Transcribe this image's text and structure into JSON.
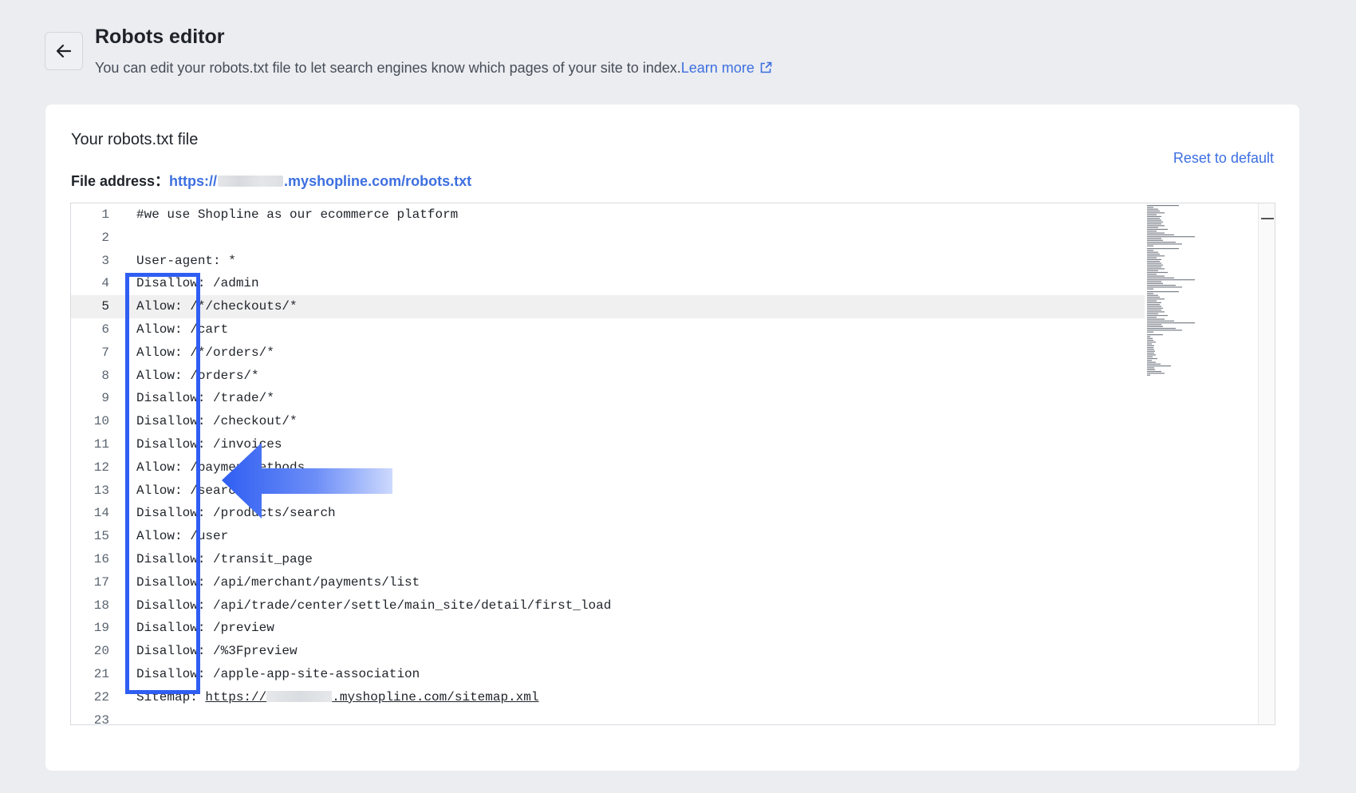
{
  "header": {
    "title": "Robots editor",
    "subtitle": "You can edit your robots.txt file to let search engines know which pages of your site to index.",
    "learn_more": "Learn more"
  },
  "card": {
    "title": "Your robots.txt file",
    "reset_label": "Reset to default",
    "file_address_label": "File address：",
    "file_address_prefix": "https://",
    "file_address_suffix": ".myshopline.com/robots.txt"
  },
  "editor": {
    "active_line": 5,
    "lines": [
      {
        "num": "1",
        "text": "#we use Shopline as our ecommerce platform"
      },
      {
        "num": "2",
        "text": ""
      },
      {
        "num": "3",
        "text": "User-agent: *"
      },
      {
        "num": "4",
        "text": "Disallow: /admin"
      },
      {
        "num": "5",
        "text": "Allow: /*/checkouts/*"
      },
      {
        "num": "6",
        "text": "Allow: /cart"
      },
      {
        "num": "7",
        "text": "Allow: /*/orders/*"
      },
      {
        "num": "8",
        "text": "Allow: /orders/*"
      },
      {
        "num": "9",
        "text": "Disallow: /trade/*"
      },
      {
        "num": "10",
        "text": "Disallow: /checkout/*"
      },
      {
        "num": "11",
        "text": "Disallow: /invoices"
      },
      {
        "num": "12",
        "text": "Allow: /paymentMethods"
      },
      {
        "num": "13",
        "text": "Allow: /search"
      },
      {
        "num": "14",
        "text": "Disallow: /products/search"
      },
      {
        "num": "15",
        "text": "Allow: /user"
      },
      {
        "num": "16",
        "text": "Disallow: /transit_page"
      },
      {
        "num": "17",
        "text": "Disallow: /api/merchant/payments/list"
      },
      {
        "num": "18",
        "text": "Disallow: /api/trade/center/settle/main_site/detail/first_load"
      },
      {
        "num": "19",
        "text": "Disallow: /preview"
      },
      {
        "num": "20",
        "text": "Disallow: /%3Fpreview"
      },
      {
        "num": "21",
        "text": "Disallow: /apple-app-site-association"
      },
      {
        "num": "22",
        "text": "Sitemap: "
      },
      {
        "num": "23",
        "text": ""
      }
    ],
    "sitemap_prefix": "https://",
    "sitemap_suffix": ".myshopline.com/sitemap.xml"
  },
  "annotation": {
    "box_color": "#2f5ef2",
    "arrow_color": "#3d6ff7"
  },
  "colors": {
    "link": "#3d6fe0",
    "background": "#ebedf1"
  },
  "icons": [
    "arrow-left-icon",
    "external-link-icon"
  ]
}
